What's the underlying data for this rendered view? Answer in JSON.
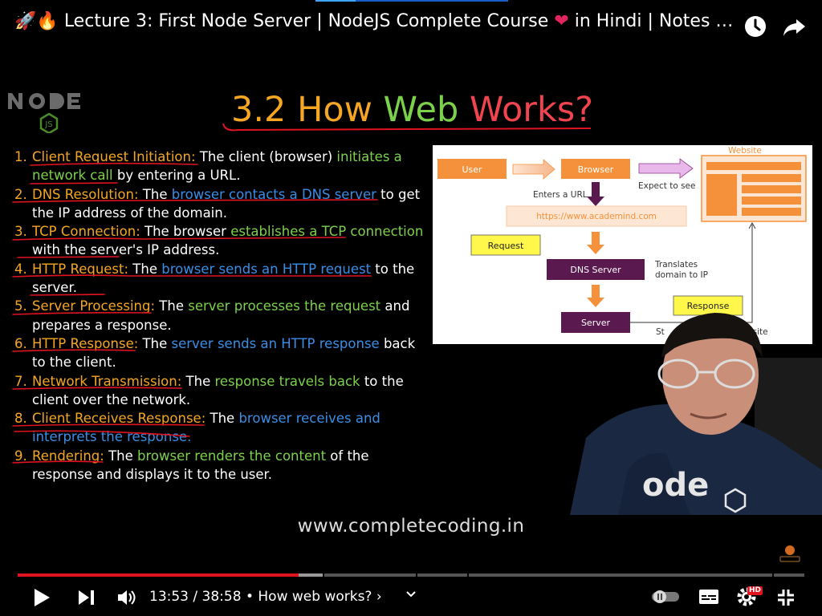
{
  "video": {
    "title": "Lecture 3: First Node Server | NodeJS Complete Course",
    "title_suffix": "in Hindi | Notes |...",
    "title_emojis": [
      "rocket",
      "fire"
    ],
    "current_time": "13:53",
    "duration": "38:58",
    "chapter": "How web works?",
    "progress_fraction": 0.357
  },
  "slide": {
    "title_number": "3.2",
    "title_parts": [
      "How",
      "Web",
      "Works?"
    ],
    "website": "www.completecoding.in",
    "steps": [
      {
        "num": "1.",
        "term": "Client Request Initiation:",
        "parts": [
          " The client (browser) ",
          "initiates a network call",
          " by entering a URL."
        ]
      },
      {
        "num": "2.",
        "term": "DNS Resolution:",
        "parts": [
          " The ",
          "browser contacts a DNS server",
          " to get the IP address of the domain."
        ]
      },
      {
        "num": "3.",
        "term": "TCP Connection:",
        "parts": [
          " The browser ",
          "establishes a TCP connection",
          " with the server's IP address."
        ]
      },
      {
        "num": "4.",
        "term": "HTTP Request:",
        "parts": [
          " The ",
          "browser sends an HTTP request",
          " to the server."
        ]
      },
      {
        "num": "5.",
        "term": "Server Processing:",
        "parts": [
          " The ",
          "server processes the request",
          " and prepares a response."
        ]
      },
      {
        "num": "6.",
        "term": "HTTP Response:",
        "parts": [
          " The ",
          "server sends an HTTP response",
          " back to the client."
        ]
      },
      {
        "num": "7.",
        "term": "Network Transmission:",
        "parts": [
          " The ",
          "response travels back",
          " to the client over the network."
        ]
      },
      {
        "num": "8.",
        "term": "Client Receives Response:",
        "parts": [
          " The ",
          "browser receives and interprets the response.",
          ""
        ]
      },
      {
        "num": "9.",
        "term": "Rendering:",
        "parts": [
          " The ",
          "browser renders the content",
          " of the response and displays it to the user."
        ]
      }
    ]
  },
  "diagram": {
    "website_label": "Website",
    "user": "User",
    "browser": "Browser",
    "expect": "Expect to see",
    "enters_url": "Enters a URL",
    "url": "https://www.academind.com",
    "request": "Request",
    "dns": "DNS Server",
    "translates": "Translates domain to IP",
    "translates_l1": "Translates",
    "translates_l2": "domain to IP",
    "response": "Response",
    "server": "Server",
    "sends_partial_a": "St",
    "sends_partial_b": "bsite"
  },
  "colors": {
    "accent_orange": "#f5a623",
    "accent_green": "#7cd14b",
    "accent_blue": "#3a8ee6",
    "title_red": "#f0444f",
    "youtube_red": "#e1131f",
    "diagram_orange": "#f5913a",
    "diagram_purple": "#5b1a4f",
    "diagram_yellow": "#fff74a"
  },
  "icons": {
    "watch_later": "clock-icon",
    "share": "share-arrow-icon",
    "play": "play-icon",
    "next": "skip-next-icon",
    "volume": "volume-icon",
    "autoplay": "autoplay-toggle-icon",
    "subtitles": "subtitles-icon",
    "settings": "settings-gear-icon",
    "fullscreen": "fullscreen-icon"
  },
  "badges": {
    "settings": "HD"
  }
}
